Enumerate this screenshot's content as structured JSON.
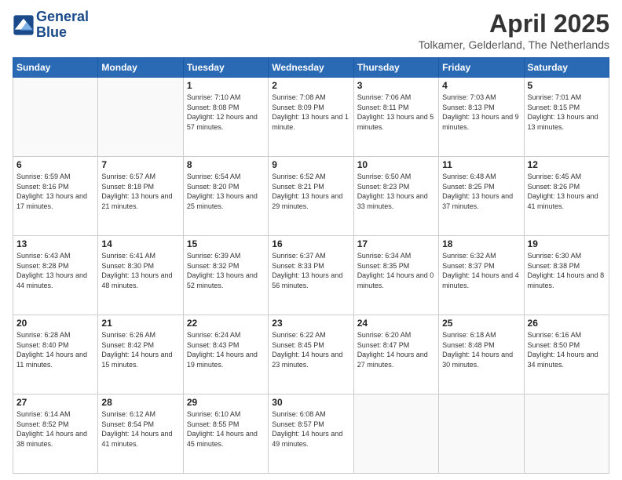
{
  "header": {
    "logo_line1": "General",
    "logo_line2": "Blue",
    "month": "April 2025",
    "location": "Tolkamer, Gelderland, The Netherlands"
  },
  "weekdays": [
    "Sunday",
    "Monday",
    "Tuesday",
    "Wednesday",
    "Thursday",
    "Friday",
    "Saturday"
  ],
  "weeks": [
    [
      {
        "day": "",
        "info": ""
      },
      {
        "day": "",
        "info": ""
      },
      {
        "day": "1",
        "info": "Sunrise: 7:10 AM\nSunset: 8:08 PM\nDaylight: 12 hours and 57 minutes."
      },
      {
        "day": "2",
        "info": "Sunrise: 7:08 AM\nSunset: 8:09 PM\nDaylight: 13 hours and 1 minute."
      },
      {
        "day": "3",
        "info": "Sunrise: 7:06 AM\nSunset: 8:11 PM\nDaylight: 13 hours and 5 minutes."
      },
      {
        "day": "4",
        "info": "Sunrise: 7:03 AM\nSunset: 8:13 PM\nDaylight: 13 hours and 9 minutes."
      },
      {
        "day": "5",
        "info": "Sunrise: 7:01 AM\nSunset: 8:15 PM\nDaylight: 13 hours and 13 minutes."
      }
    ],
    [
      {
        "day": "6",
        "info": "Sunrise: 6:59 AM\nSunset: 8:16 PM\nDaylight: 13 hours and 17 minutes."
      },
      {
        "day": "7",
        "info": "Sunrise: 6:57 AM\nSunset: 8:18 PM\nDaylight: 13 hours and 21 minutes."
      },
      {
        "day": "8",
        "info": "Sunrise: 6:54 AM\nSunset: 8:20 PM\nDaylight: 13 hours and 25 minutes."
      },
      {
        "day": "9",
        "info": "Sunrise: 6:52 AM\nSunset: 8:21 PM\nDaylight: 13 hours and 29 minutes."
      },
      {
        "day": "10",
        "info": "Sunrise: 6:50 AM\nSunset: 8:23 PM\nDaylight: 13 hours and 33 minutes."
      },
      {
        "day": "11",
        "info": "Sunrise: 6:48 AM\nSunset: 8:25 PM\nDaylight: 13 hours and 37 minutes."
      },
      {
        "day": "12",
        "info": "Sunrise: 6:45 AM\nSunset: 8:26 PM\nDaylight: 13 hours and 41 minutes."
      }
    ],
    [
      {
        "day": "13",
        "info": "Sunrise: 6:43 AM\nSunset: 8:28 PM\nDaylight: 13 hours and 44 minutes."
      },
      {
        "day": "14",
        "info": "Sunrise: 6:41 AM\nSunset: 8:30 PM\nDaylight: 13 hours and 48 minutes."
      },
      {
        "day": "15",
        "info": "Sunrise: 6:39 AM\nSunset: 8:32 PM\nDaylight: 13 hours and 52 minutes."
      },
      {
        "day": "16",
        "info": "Sunrise: 6:37 AM\nSunset: 8:33 PM\nDaylight: 13 hours and 56 minutes."
      },
      {
        "day": "17",
        "info": "Sunrise: 6:34 AM\nSunset: 8:35 PM\nDaylight: 14 hours and 0 minutes."
      },
      {
        "day": "18",
        "info": "Sunrise: 6:32 AM\nSunset: 8:37 PM\nDaylight: 14 hours and 4 minutes."
      },
      {
        "day": "19",
        "info": "Sunrise: 6:30 AM\nSunset: 8:38 PM\nDaylight: 14 hours and 8 minutes."
      }
    ],
    [
      {
        "day": "20",
        "info": "Sunrise: 6:28 AM\nSunset: 8:40 PM\nDaylight: 14 hours and 11 minutes."
      },
      {
        "day": "21",
        "info": "Sunrise: 6:26 AM\nSunset: 8:42 PM\nDaylight: 14 hours and 15 minutes."
      },
      {
        "day": "22",
        "info": "Sunrise: 6:24 AM\nSunset: 8:43 PM\nDaylight: 14 hours and 19 minutes."
      },
      {
        "day": "23",
        "info": "Sunrise: 6:22 AM\nSunset: 8:45 PM\nDaylight: 14 hours and 23 minutes."
      },
      {
        "day": "24",
        "info": "Sunrise: 6:20 AM\nSunset: 8:47 PM\nDaylight: 14 hours and 27 minutes."
      },
      {
        "day": "25",
        "info": "Sunrise: 6:18 AM\nSunset: 8:48 PM\nDaylight: 14 hours and 30 minutes."
      },
      {
        "day": "26",
        "info": "Sunrise: 6:16 AM\nSunset: 8:50 PM\nDaylight: 14 hours and 34 minutes."
      }
    ],
    [
      {
        "day": "27",
        "info": "Sunrise: 6:14 AM\nSunset: 8:52 PM\nDaylight: 14 hours and 38 minutes."
      },
      {
        "day": "28",
        "info": "Sunrise: 6:12 AM\nSunset: 8:54 PM\nDaylight: 14 hours and 41 minutes."
      },
      {
        "day": "29",
        "info": "Sunrise: 6:10 AM\nSunset: 8:55 PM\nDaylight: 14 hours and 45 minutes."
      },
      {
        "day": "30",
        "info": "Sunrise: 6:08 AM\nSunset: 8:57 PM\nDaylight: 14 hours and 49 minutes."
      },
      {
        "day": "",
        "info": ""
      },
      {
        "day": "",
        "info": ""
      },
      {
        "day": "",
        "info": ""
      }
    ]
  ]
}
